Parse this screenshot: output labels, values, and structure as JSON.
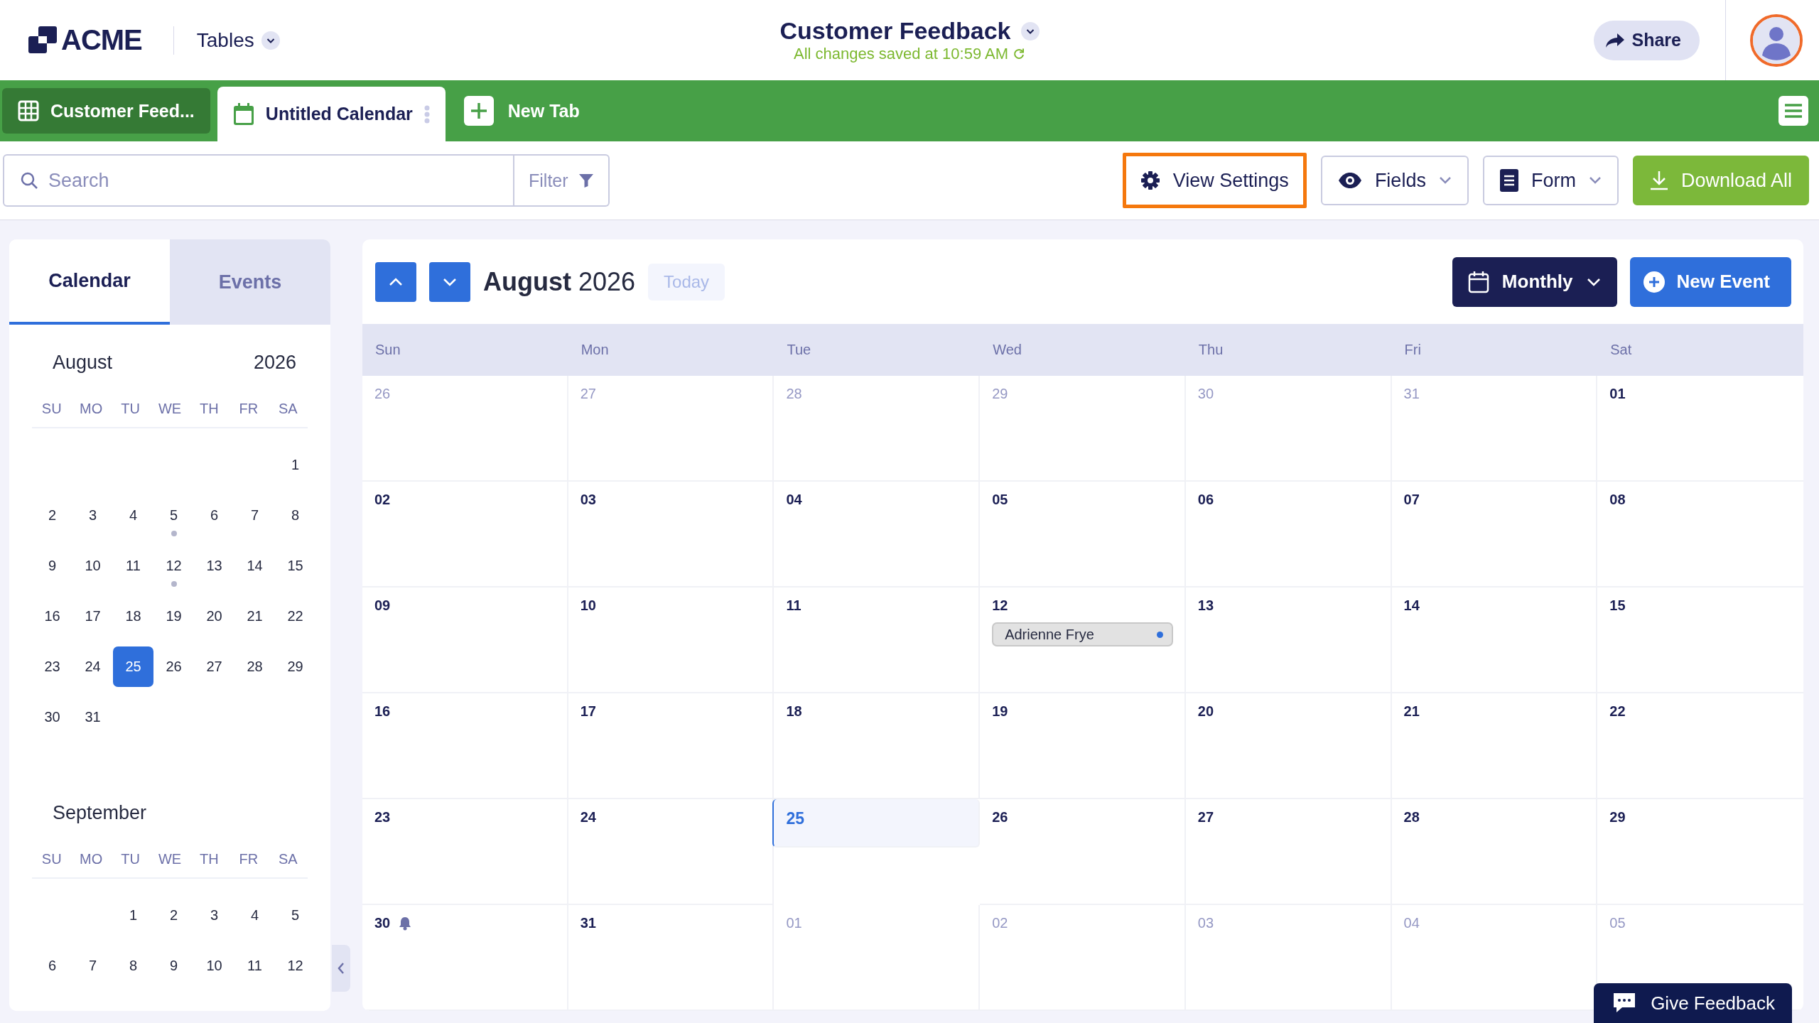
{
  "header": {
    "logo": "ACME",
    "app_menu": "Tables",
    "title": "Customer Feedback",
    "save_status": "All changes saved at 10:59 AM",
    "share": "Share"
  },
  "tabs": [
    {
      "label": "Customer Feed...",
      "kind": "table",
      "selected": false
    },
    {
      "label": "Untitled Calendar",
      "kind": "calendar",
      "selected": true
    }
  ],
  "new_tab": "New Tab",
  "toolbar": {
    "search": {
      "placeholder": "Search"
    },
    "filter": "Filter",
    "buttons": [
      {
        "label": "View Settings",
        "kind": "settings",
        "highlighted": true
      },
      {
        "label": "Fields",
        "kind": "fields",
        "highlighted": false
      },
      {
        "label": "Form",
        "kind": "form",
        "highlighted": false
      },
      {
        "label": "Download All",
        "kind": "download",
        "highlighted": false
      }
    ]
  },
  "sidebar": {
    "tabs": [
      {
        "label": "Calendar",
        "selected": true
      },
      {
        "label": "Events",
        "selected": false
      }
    ],
    "months": [
      {
        "name": "August",
        "year": "2026",
        "weekdays": [
          "SU",
          "MO",
          "TU",
          "WE",
          "TH",
          "FR",
          "SA"
        ],
        "days": [
          {
            "kind": "blank"
          },
          {
            "kind": "blank"
          },
          {
            "kind": "blank"
          },
          {
            "kind": "blank"
          },
          {
            "kind": "blank"
          },
          {
            "kind": "blank"
          },
          {
            "kind": "date",
            "day": "1",
            "selected": false,
            "has_event": false
          },
          {
            "day": "2",
            "selected": false,
            "has_event": false
          },
          {
            "day": "3",
            "selected": false,
            "has_event": false
          },
          {
            "day": "4",
            "selected": false,
            "has_event": false
          },
          {
            "day": "5",
            "selected": false,
            "has_event": true
          },
          {
            "day": "6",
            "selected": false,
            "has_event": false
          },
          {
            "day": "7",
            "selected": false,
            "has_event": false
          },
          {
            "day": "8",
            "selected": false,
            "has_event": false
          },
          {
            "day": "9",
            "selected": false,
            "has_event": false
          },
          {
            "day": "10",
            "selected": false,
            "has_event": false
          },
          {
            "day": "11",
            "selected": false,
            "has_event": false
          },
          {
            "day": "12",
            "selected": false,
            "has_event": true
          },
          {
            "day": "13",
            "selected": false,
            "has_event": false
          },
          {
            "day": "14",
            "selected": false,
            "has_event": false
          },
          {
            "day": "15",
            "selected": false,
            "has_event": false
          },
          {
            "day": "16",
            "selected": false,
            "has_event": false
          },
          {
            "day": "17",
            "selected": false,
            "has_event": false
          },
          {
            "day": "18",
            "selected": false,
            "has_event": false
          },
          {
            "day": "19",
            "selected": false,
            "has_event": false
          },
          {
            "day": "20",
            "selected": false,
            "has_event": false
          },
          {
            "day": "21",
            "selected": false,
            "has_event": false
          },
          {
            "day": "22",
            "selected": false,
            "has_event": false
          },
          {
            "day": "23",
            "selected": false,
            "has_event": false
          },
          {
            "day": "24",
            "selected": false,
            "has_event": false
          },
          {
            "day": "25",
            "selected": true,
            "has_event": false
          },
          {
            "day": "26",
            "selected": false,
            "has_event": false
          },
          {
            "day": "27",
            "selected": false,
            "has_event": false
          },
          {
            "day": "28",
            "selected": false,
            "has_event": false
          },
          {
            "day": "29",
            "selected": false,
            "has_event": false
          },
          {
            "day": "30",
            "selected": false,
            "has_event": false
          },
          {
            "day": "31",
            "selected": false,
            "has_event": false
          }
        ]
      },
      {
        "name": "September",
        "weekdays": [
          "SU",
          "MO",
          "TU",
          "WE",
          "TH",
          "FR",
          "SA"
        ],
        "days": [
          {
            "kind": "blank"
          },
          {
            "kind": "blank"
          },
          {
            "day": "1",
            "selected": false,
            "has_event": false
          },
          {
            "day": "2",
            "selected": false,
            "has_event": false
          },
          {
            "day": "3",
            "selected": false,
            "has_event": false
          },
          {
            "day": "4",
            "selected": false,
            "has_event": false
          },
          {
            "day": "5",
            "selected": false,
            "has_event": false
          },
          {
            "day": "6",
            "selected": false,
            "has_event": false
          },
          {
            "day": "7",
            "selected": false,
            "has_event": false
          },
          {
            "day": "8",
            "selected": false,
            "has_event": false
          },
          {
            "day": "9",
            "selected": false,
            "has_event": false
          },
          {
            "day": "10",
            "selected": false,
            "has_event": false
          },
          {
            "day": "11",
            "selected": false,
            "has_event": false
          },
          {
            "day": "12",
            "selected": false,
            "has_event": false
          }
        ]
      }
    ]
  },
  "calendar": {
    "month": "August",
    "year": "2026",
    "today_button": "Today",
    "view": "Monthly",
    "new_event": "New Event",
    "weekdays": [
      "Sun",
      "Mon",
      "Tue",
      "Wed",
      "Thu",
      "Fri",
      "Sat"
    ],
    "cells": [
      {
        "day": "26",
        "in_month": false,
        "today": false,
        "reminder": false
      },
      {
        "day": "27",
        "in_month": false,
        "today": false,
        "reminder": false
      },
      {
        "day": "28",
        "in_month": false,
        "today": false,
        "reminder": false
      },
      {
        "day": "29",
        "in_month": false,
        "today": false,
        "reminder": false
      },
      {
        "day": "30",
        "in_month": false,
        "today": false,
        "reminder": false
      },
      {
        "day": "31",
        "in_month": false,
        "today": false,
        "reminder": false
      },
      {
        "day": "01",
        "in_month": true,
        "today": false,
        "reminder": false
      },
      {
        "day": "02",
        "in_month": true,
        "today": false,
        "reminder": false
      },
      {
        "day": "03",
        "in_month": true,
        "today": false,
        "reminder": false
      },
      {
        "day": "04",
        "in_month": true,
        "today": false,
        "reminder": false
      },
      {
        "day": "05",
        "in_month": true,
        "today": false,
        "reminder": false
      },
      {
        "day": "06",
        "in_month": true,
        "today": false,
        "reminder": false
      },
      {
        "day": "07",
        "in_month": true,
        "today": false,
        "reminder": false
      },
      {
        "day": "08",
        "in_month": true,
        "today": false,
        "reminder": false
      },
      {
        "day": "09",
        "in_month": true,
        "today": false,
        "reminder": false
      },
      {
        "day": "10",
        "in_month": true,
        "today": false,
        "reminder": false
      },
      {
        "day": "11",
        "in_month": true,
        "today": false,
        "reminder": false
      },
      {
        "day": "12",
        "in_month": true,
        "today": false,
        "reminder": false,
        "events": [
          {
            "title": "Adrienne Frye",
            "color": "#2f6fdb"
          }
        ]
      },
      {
        "day": "13",
        "in_month": true,
        "today": false,
        "reminder": false
      },
      {
        "day": "14",
        "in_month": true,
        "today": false,
        "reminder": false
      },
      {
        "day": "15",
        "in_month": true,
        "today": false,
        "reminder": false
      },
      {
        "day": "16",
        "in_month": true,
        "today": false,
        "reminder": false
      },
      {
        "day": "17",
        "in_month": true,
        "today": false,
        "reminder": false
      },
      {
        "day": "18",
        "in_month": true,
        "today": false,
        "reminder": false
      },
      {
        "day": "19",
        "in_month": true,
        "today": false,
        "reminder": false
      },
      {
        "day": "20",
        "in_month": true,
        "today": false,
        "reminder": false
      },
      {
        "day": "21",
        "in_month": true,
        "today": false,
        "reminder": false
      },
      {
        "day": "22",
        "in_month": true,
        "today": false,
        "reminder": false
      },
      {
        "day": "23",
        "in_month": true,
        "today": false,
        "reminder": false
      },
      {
        "day": "24",
        "in_month": true,
        "today": false,
        "reminder": false
      },
      {
        "day": "25",
        "in_month": true,
        "today": true,
        "reminder": false
      },
      {
        "day": "26",
        "in_month": true,
        "today": false,
        "reminder": false
      },
      {
        "day": "27",
        "in_month": true,
        "today": false,
        "reminder": false
      },
      {
        "day": "28",
        "in_month": true,
        "today": false,
        "reminder": false
      },
      {
        "day": "29",
        "in_month": true,
        "today": false,
        "reminder": false
      },
      {
        "day": "30",
        "in_month": true,
        "today": false,
        "reminder": true
      },
      {
        "day": "31",
        "in_month": true,
        "today": false,
        "reminder": false
      },
      {
        "day": "01",
        "in_month": false,
        "today": false,
        "reminder": false
      },
      {
        "day": "02",
        "in_month": false,
        "today": false,
        "reminder": false
      },
      {
        "day": "03",
        "in_month": false,
        "today": false,
        "reminder": false
      },
      {
        "day": "04",
        "in_month": false,
        "today": false,
        "reminder": false
      },
      {
        "day": "05",
        "in_month": false,
        "today": false,
        "reminder": false
      }
    ]
  },
  "feedback_button": "Give Feedback"
}
